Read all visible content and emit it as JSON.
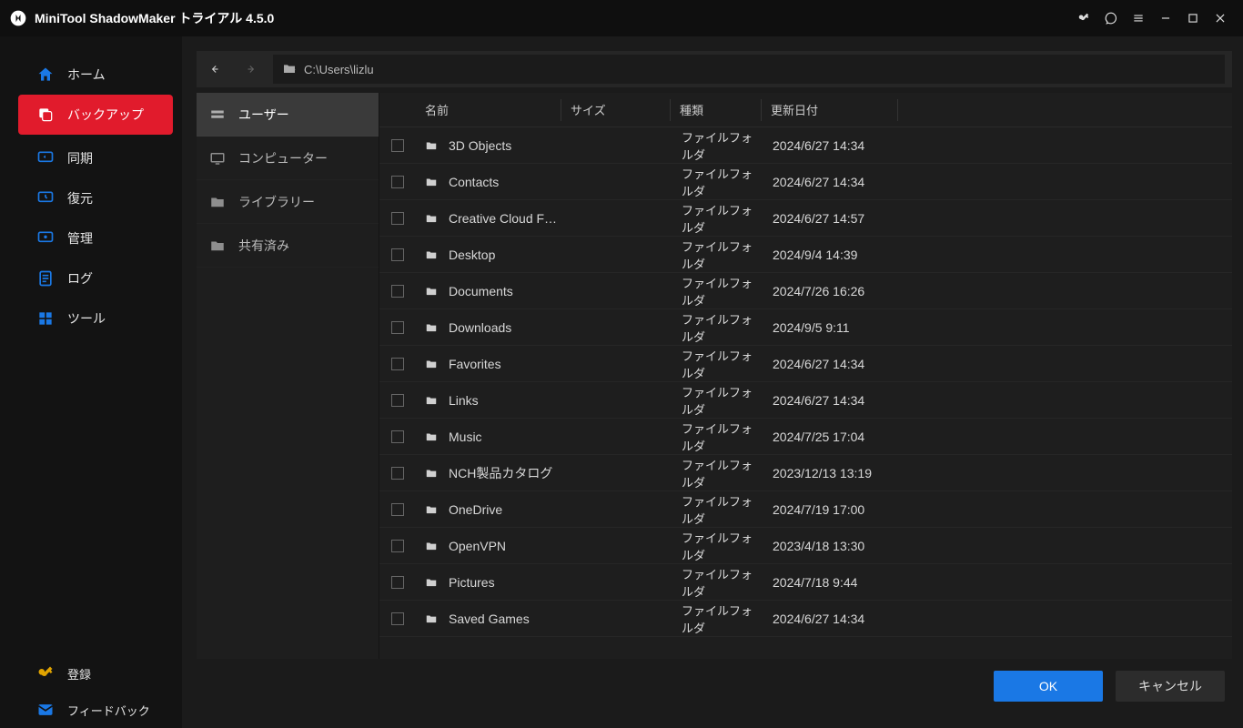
{
  "app": {
    "title": "MiniTool ShadowMaker トライアル 4.5.0"
  },
  "sidebar": {
    "items": [
      {
        "label": "ホーム"
      },
      {
        "label": "バックアップ"
      },
      {
        "label": "同期"
      },
      {
        "label": "復元"
      },
      {
        "label": "管理"
      },
      {
        "label": "ログ"
      },
      {
        "label": "ツール"
      }
    ],
    "bottom": [
      {
        "label": "登録"
      },
      {
        "label": "フィードバック"
      }
    ]
  },
  "pathbar": {
    "path": "C:\\Users\\lizlu"
  },
  "places": [
    {
      "label": "ユーザー"
    },
    {
      "label": "コンピューター"
    },
    {
      "label": "ライブラリー"
    },
    {
      "label": "共有済み"
    }
  ],
  "columns": {
    "name": "名前",
    "size": "サイズ",
    "kind": "種類",
    "date": "更新日付"
  },
  "files": [
    {
      "name": "3D Objects",
      "kind": "ファイルフォルダ",
      "date": "2024/6/27 14:34"
    },
    {
      "name": "Contacts",
      "kind": "ファイルフォルダ",
      "date": "2024/6/27 14:34"
    },
    {
      "name": "Creative Cloud F…",
      "kind": "ファイルフォルダ",
      "date": "2024/6/27 14:57"
    },
    {
      "name": "Desktop",
      "kind": "ファイルフォルダ",
      "date": "2024/9/4 14:39"
    },
    {
      "name": "Documents",
      "kind": "ファイルフォルダ",
      "date": "2024/7/26 16:26"
    },
    {
      "name": "Downloads",
      "kind": "ファイルフォルダ",
      "date": "2024/9/5 9:11"
    },
    {
      "name": "Favorites",
      "kind": "ファイルフォルダ",
      "date": "2024/6/27 14:34"
    },
    {
      "name": "Links",
      "kind": "ファイルフォルダ",
      "date": "2024/6/27 14:34"
    },
    {
      "name": "Music",
      "kind": "ファイルフォルダ",
      "date": "2024/7/25 17:04"
    },
    {
      "name": "NCH製品カタログ",
      "kind": "ファイルフォルダ",
      "date": "2023/12/13 13:19"
    },
    {
      "name": "OneDrive",
      "kind": "ファイルフォルダ",
      "date": "2024/7/19 17:00"
    },
    {
      "name": "OpenVPN",
      "kind": "ファイルフォルダ",
      "date": "2023/4/18 13:30"
    },
    {
      "name": "Pictures",
      "kind": "ファイルフォルダ",
      "date": "2024/7/18 9:44"
    },
    {
      "name": "Saved Games",
      "kind": "ファイルフォルダ",
      "date": "2024/6/27 14:34"
    }
  ],
  "footer": {
    "ok": "OK",
    "cancel": "キャンセル"
  }
}
